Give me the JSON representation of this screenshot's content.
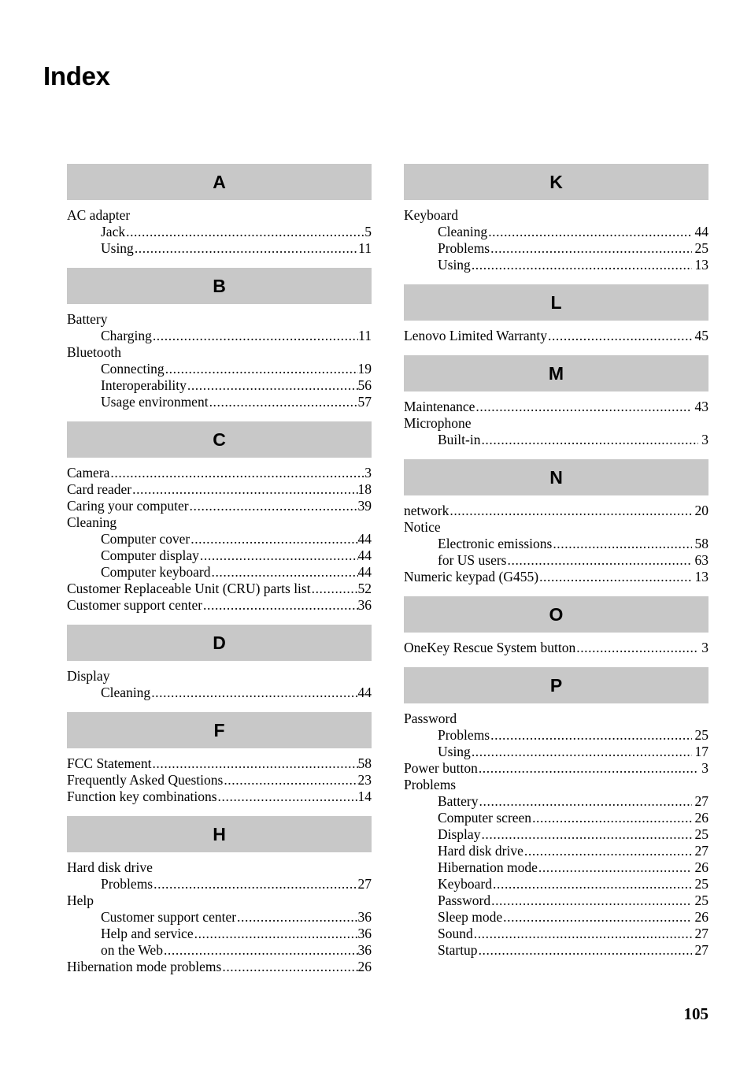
{
  "document": {
    "title": "Index",
    "folio": "105"
  },
  "columns": [
    {
      "id": "left",
      "sections": [
        {
          "letter": "A",
          "entries": [
            {
              "label": "AC adapter",
              "page": "",
              "level": 0
            },
            {
              "label": "Jack",
              "page": "5",
              "level": 1
            },
            {
              "label": "Using",
              "page": "11",
              "level": 1
            }
          ]
        },
        {
          "letter": "B",
          "entries": [
            {
              "label": "Battery",
              "page": "",
              "level": 0
            },
            {
              "label": "Charging",
              "page": "11",
              "level": 1
            },
            {
              "label": "Bluetooth",
              "page": "",
              "level": 0
            },
            {
              "label": "Connecting",
              "page": "19",
              "level": 1
            },
            {
              "label": "Interoperability",
              "page": "56",
              "level": 1
            },
            {
              "label": "Usage environment",
              "page": "57",
              "level": 1
            }
          ]
        },
        {
          "letter": "C",
          "entries": [
            {
              "label": "Camera",
              "page": "3",
              "level": 0
            },
            {
              "label": "Card reader",
              "page": "18",
              "level": 0
            },
            {
              "label": "Caring your computer",
              "page": "39",
              "level": 0
            },
            {
              "label": "Cleaning",
              "page": "",
              "level": 0
            },
            {
              "label": "Computer cover",
              "page": "44",
              "level": 1
            },
            {
              "label": "Computer display",
              "page": "44",
              "level": 1
            },
            {
              "label": "Computer keyboard",
              "page": "44",
              "level": 1
            },
            {
              "label": "Customer Replaceable Unit (CRU) parts list",
              "page": "52",
              "level": 0
            },
            {
              "label": "Customer support center",
              "page": "36",
              "level": 0
            }
          ]
        },
        {
          "letter": "D",
          "entries": [
            {
              "label": "Display",
              "page": "",
              "level": 0
            },
            {
              "label": "Cleaning",
              "page": "44",
              "level": 1
            }
          ]
        },
        {
          "letter": "F",
          "entries": [
            {
              "label": "FCC Statement",
              "page": "58",
              "level": 0
            },
            {
              "label": "Frequently Asked Questions",
              "page": "23",
              "level": 0
            },
            {
              "label": "Function key combinations",
              "page": "14",
              "level": 0
            }
          ]
        },
        {
          "letter": "H",
          "entries": [
            {
              "label": "Hard disk drive",
              "page": "",
              "level": 0
            },
            {
              "label": "Problems",
              "page": "27",
              "level": 1
            },
            {
              "label": "Help",
              "page": "",
              "level": 0
            },
            {
              "label": "Customer support center",
              "page": "36",
              "level": 1
            },
            {
              "label": "Help and service",
              "page": "36",
              "level": 1
            },
            {
              "label": "on the Web",
              "page": "36",
              "level": 1
            },
            {
              "label": "Hibernation mode problems",
              "page": "26",
              "level": 0
            }
          ]
        }
      ]
    },
    {
      "id": "right",
      "sections": [
        {
          "letter": "K",
          "entries": [
            {
              "label": "Keyboard",
              "page": "",
              "level": 0
            },
            {
              "label": "Cleaning",
              "page": "44",
              "level": 1
            },
            {
              "label": "Problems",
              "page": "25",
              "level": 1
            },
            {
              "label": "Using",
              "page": "13",
              "level": 1
            }
          ]
        },
        {
          "letter": "L",
          "entries": [
            {
              "label": "Lenovo Limited Warranty",
              "page": "45",
              "level": 0
            }
          ]
        },
        {
          "letter": "M",
          "entries": [
            {
              "label": "Maintenance",
              "page": "43",
              "level": 0
            },
            {
              "label": "Microphone",
              "page": "",
              "level": 0
            },
            {
              "label": "Built-in",
              "page": "3",
              "level": 1
            }
          ]
        },
        {
          "letter": "N",
          "entries": [
            {
              "label": "network",
              "page": "20",
              "level": 0
            },
            {
              "label": "Notice",
              "page": "",
              "level": 0
            },
            {
              "label": "Electronic emissions",
              "page": "58",
              "level": 1
            },
            {
              "label": "for US users",
              "page": "63",
              "level": 1
            },
            {
              "label": "Numeric keypad (G455)",
              "page": "13",
              "level": 0
            }
          ]
        },
        {
          "letter": "O",
          "entries": [
            {
              "label": "OneKey Rescue System button",
              "page": "3",
              "level": 0
            }
          ]
        },
        {
          "letter": "P",
          "entries": [
            {
              "label": "Password",
              "page": "",
              "level": 0
            },
            {
              "label": "Problems",
              "page": "25",
              "level": 1
            },
            {
              "label": "Using",
              "page": "17",
              "level": 1
            },
            {
              "label": "Power button",
              "page": "3",
              "level": 0
            },
            {
              "label": "Problems",
              "page": "",
              "level": 0
            },
            {
              "label": "Battery",
              "page": "27",
              "level": 1
            },
            {
              "label": "Computer screen",
              "page": "26",
              "level": 1
            },
            {
              "label": "Display",
              "page": "25",
              "level": 1
            },
            {
              "label": "Hard disk drive",
              "page": "27",
              "level": 1
            },
            {
              "label": "Hibernation mode",
              "page": "26",
              "level": 1
            },
            {
              "label": "Keyboard",
              "page": "25",
              "level": 1
            },
            {
              "label": "Password",
              "page": "25",
              "level": 1
            },
            {
              "label": "Sleep mode",
              "page": "26",
              "level": 1
            },
            {
              "label": "Sound",
              "page": "27",
              "level": 1
            },
            {
              "label": "Startup",
              "page": "27",
              "level": 1
            }
          ]
        }
      ]
    }
  ]
}
